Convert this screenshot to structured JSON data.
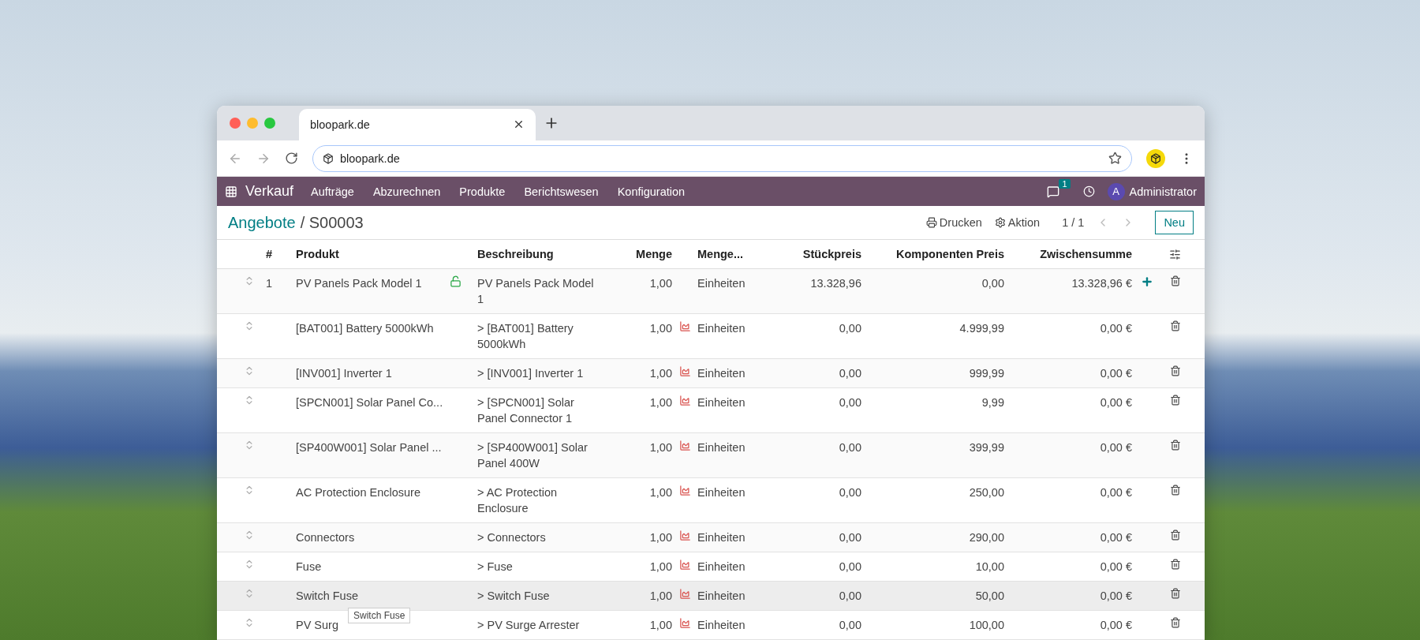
{
  "browser": {
    "tab_title": "bloopark.de",
    "url": "bloopark.de"
  },
  "navbar": {
    "app": "Verkauf",
    "menu": [
      "Aufträge",
      "Abzurechnen",
      "Produkte",
      "Berichtswesen",
      "Konfiguration"
    ],
    "messages_badge": "1",
    "avatar": "A",
    "user": "Administrator"
  },
  "control_panel": {
    "breadcrumb": "Angebote",
    "record": "/ S00003",
    "print": "Drucken",
    "action": "Aktion",
    "pager": "1 / 1",
    "new_button": "Neu"
  },
  "table": {
    "columns": [
      "#",
      "Produkt",
      "Beschreibung",
      "Menge",
      "Menge...",
      "Stückpreis",
      "Komponenten Preis",
      "Zwischensumme"
    ],
    "rows": [
      {
        "kind": "pack",
        "sequence": "1",
        "product": "PV Panels Pack Model 1",
        "description": "PV Panels Pack Model 1",
        "quantity": "1,00",
        "unit": "Einheiten",
        "unit_price": "13.328,96",
        "component_price": "0,00",
        "subtotal": "13.328,96 €",
        "highlighted": false
      },
      {
        "kind": "component",
        "product": "[BAT001] Battery 5000kWh",
        "description": "> [BAT001] Battery 5000kWh",
        "quantity": "1,00",
        "unit": "Einheiten",
        "unit_price": "0,00",
        "component_price": "4.999,99",
        "subtotal": "0,00 €",
        "highlighted": false
      },
      {
        "kind": "component",
        "product": "[INV001] Inverter 1",
        "description": "> [INV001] Inverter 1",
        "quantity": "1,00",
        "unit": "Einheiten",
        "unit_price": "0,00",
        "component_price": "999,99",
        "subtotal": "0,00 €",
        "highlighted": false
      },
      {
        "kind": "component",
        "product": "[SPCN001] Solar Panel Co...",
        "description": "> [SPCN001] Solar Panel Connector 1",
        "quantity": "1,00",
        "unit": "Einheiten",
        "unit_price": "0,00",
        "component_price": "9,99",
        "subtotal": "0,00 €",
        "highlighted": false
      },
      {
        "kind": "component",
        "product": "[SP400W001] Solar Panel ...",
        "description": "> [SP400W001] Solar Panel 400W",
        "quantity": "1,00",
        "unit": "Einheiten",
        "unit_price": "0,00",
        "component_price": "399,99",
        "subtotal": "0,00 €",
        "highlighted": false
      },
      {
        "kind": "component",
        "product": "AC Protection Enclosure",
        "description": "> AC Protection Enclosure",
        "quantity": "1,00",
        "unit": "Einheiten",
        "unit_price": "0,00",
        "component_price": "250,00",
        "subtotal": "0,00 €",
        "highlighted": false
      },
      {
        "kind": "component",
        "product": "Connectors",
        "description": "> Connectors",
        "quantity": "1,00",
        "unit": "Einheiten",
        "unit_price": "0,00",
        "component_price": "290,00",
        "subtotal": "0,00 €",
        "highlighted": false
      },
      {
        "kind": "component",
        "product": "Fuse",
        "description": "> Fuse",
        "quantity": "1,00",
        "unit": "Einheiten",
        "unit_price": "0,00",
        "component_price": "10,00",
        "subtotal": "0,00 €",
        "highlighted": false
      },
      {
        "kind": "component",
        "product": "Switch Fuse",
        "description": "> Switch Fuse",
        "quantity": "1,00",
        "unit": "Einheiten",
        "unit_price": "0,00",
        "component_price": "50,00",
        "subtotal": "0,00 €",
        "highlighted": true,
        "tooltip": "Switch Fuse"
      },
      {
        "kind": "component",
        "product": "PV Surg",
        "description": "> PV Surge Arrester",
        "quantity": "1,00",
        "unit": "Einheiten",
        "unit_price": "0,00",
        "component_price": "100,00",
        "subtotal": "0,00 €",
        "highlighted": false
      }
    ]
  }
}
